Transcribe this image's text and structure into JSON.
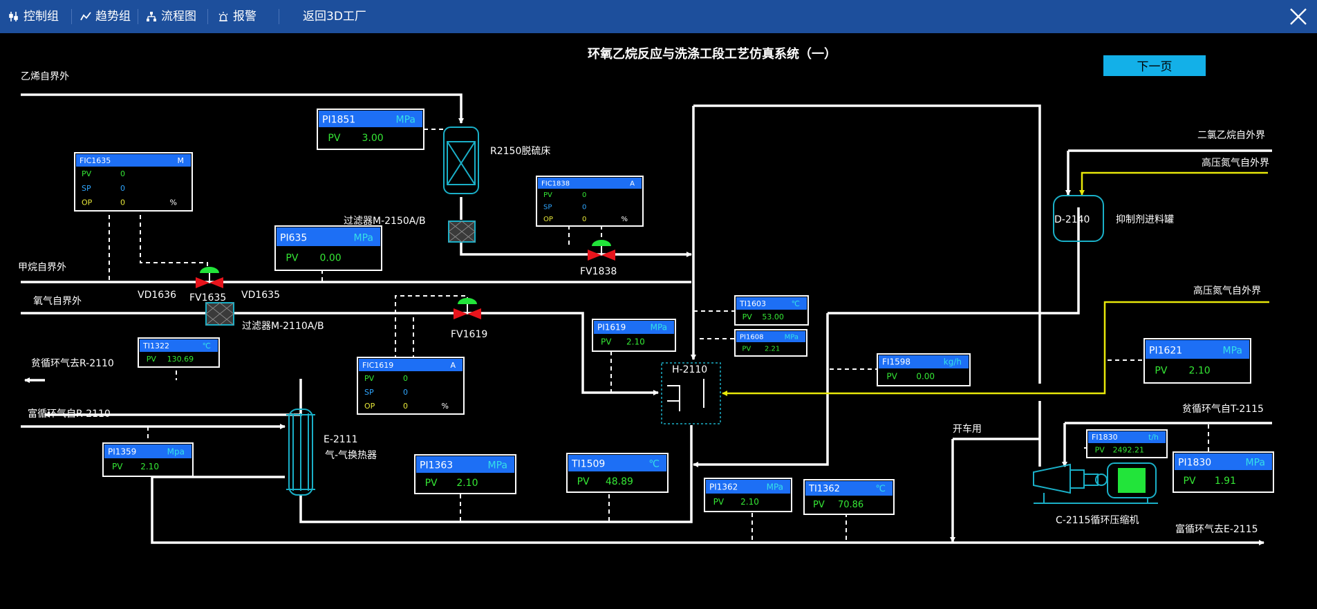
{
  "toolbar": {
    "items": [
      {
        "label": "控制组",
        "icon": "control-group-icon"
      },
      {
        "label": "趋势组",
        "icon": "trend-icon"
      },
      {
        "label": "流程图",
        "icon": "flowchart-icon"
      },
      {
        "label": "报警",
        "icon": "alarm-icon"
      }
    ],
    "back_label": "返回3D工厂",
    "close_icon": "close-icon"
  },
  "diagram": {
    "title": "环氧乙烷反应与洗涤工段工艺仿真系统（一）",
    "next_button": "下一页",
    "labels": {
      "ethylene_in": "乙烯自界外",
      "methane_in": "甲烷自界外",
      "oxygen_in": "氧气自界外",
      "lean_to_r2110": "贫循环气去R-2110",
      "rich_from_r2110": "富循环气自R-2110",
      "r2150": "R2150脱硫床",
      "filter_m2150": "过滤器M-2150A/B",
      "filter_m2110": "过滤器M-2110A/B",
      "vd1636": "VD1636",
      "fv1635": "FV1635",
      "vd1635": "VD1635",
      "fv1838": "FV1838",
      "fv1619": "FV1619",
      "e2111": "E-2111",
      "e2111_desc": "气-气换热器",
      "h2110": "H-2110",
      "d2140": "D-2140",
      "d2140_desc": "抑制剂进料罐",
      "dichloroethane_in": "二氯乙烷自外界",
      "hp_nitrogen_in_1": "高压氮气自外界",
      "hp_nitrogen_in_2": "高压氮气自外界",
      "lean_from_t2115": "贫循环气自T-2115",
      "startup": "开车用",
      "c2115": "C-2115循环压缩机",
      "rich_to_e2115": "富循环气去E-2115"
    },
    "instruments": [
      {
        "id": "pi1851",
        "tag": "PI1851",
        "unit": "MPa",
        "rows": [
          {
            "k": "PV",
            "v": "3.00"
          }
        ]
      },
      {
        "id": "fic1635",
        "tag": "FIC1635",
        "unit": "M",
        "rows": [
          {
            "k": "PV",
            "v": "0"
          },
          {
            "k": "SP",
            "v": "0"
          },
          {
            "k": "OP",
            "v": "0",
            "u": "%"
          }
        ]
      },
      {
        "id": "fic1838",
        "tag": "FIC1838",
        "unit": "A",
        "rows": [
          {
            "k": "PV",
            "v": "0"
          },
          {
            "k": "SP",
            "v": "0"
          },
          {
            "k": "OP",
            "v": "0",
            "u": "%"
          }
        ]
      },
      {
        "id": "pi635",
        "tag": "PI635",
        "unit": "MPa",
        "rows": [
          {
            "k": "PV",
            "v": "0.00"
          }
        ]
      },
      {
        "id": "ti1322",
        "tag": "TI1322",
        "unit": "℃",
        "rows": [
          {
            "k": "PV",
            "v": "130.69"
          }
        ]
      },
      {
        "id": "fic1619",
        "tag": "FIC1619",
        "unit": "A",
        "rows": [
          {
            "k": "PV",
            "v": "0"
          },
          {
            "k": "SP",
            "v": "0"
          },
          {
            "k": "OP",
            "v": "0",
            "u": "%"
          }
        ]
      },
      {
        "id": "pi1359",
        "tag": "PI1359",
        "unit": "Mpa",
        "rows": [
          {
            "k": "PV",
            "v": "2.10"
          }
        ]
      },
      {
        "id": "pi1619",
        "tag": "PI1619",
        "unit": "MPa",
        "rows": [
          {
            "k": "PV",
            "v": "2.10"
          }
        ]
      },
      {
        "id": "ti1603",
        "tag": "TI1603",
        "unit": "℃",
        "rows": [
          {
            "k": "PV",
            "v": "53.00"
          }
        ]
      },
      {
        "id": "pi1608",
        "tag": "PI1608",
        "unit": "MPa",
        "rows": [
          {
            "k": "PV",
            "v": "2.21"
          }
        ]
      },
      {
        "id": "fi1598",
        "tag": "FI1598",
        "unit": "kg/h",
        "rows": [
          {
            "k": "PV",
            "v": "0.00"
          }
        ]
      },
      {
        "id": "pi1621",
        "tag": "PI1621",
        "unit": "MPa",
        "rows": [
          {
            "k": "PV",
            "v": "2.10"
          }
        ]
      },
      {
        "id": "pi1363",
        "tag": "PI1363",
        "unit": "MPa",
        "rows": [
          {
            "k": "PV",
            "v": "2.10"
          }
        ]
      },
      {
        "id": "ti1509",
        "tag": "TI1509",
        "unit": "℃",
        "rows": [
          {
            "k": "PV",
            "v": "48.89"
          }
        ]
      },
      {
        "id": "pi1362",
        "tag": "PI1362",
        "unit": "MPa",
        "rows": [
          {
            "k": "PV",
            "v": "2.10"
          }
        ]
      },
      {
        "id": "ti1362",
        "tag": "TI1362",
        "unit": "℃",
        "rows": [
          {
            "k": "PV",
            "v": "70.86"
          }
        ]
      },
      {
        "id": "fi1830",
        "tag": "FI1830",
        "unit": "t/h",
        "rows": [
          {
            "k": "PV",
            "v": "2492.21"
          }
        ]
      },
      {
        "id": "pi1830",
        "tag": "PI1830",
        "unit": "MPa",
        "rows": [
          {
            "k": "PV",
            "v": "1.91"
          }
        ]
      }
    ],
    "colors": {
      "pv": "#35e835",
      "sp": "#2fa6ff",
      "op": "#e8e83a",
      "header": "#1d6ff5",
      "unit": "#35e0e8",
      "pipe": "#ffffff",
      "n2_pipe": "#e8e80a",
      "valve_body": "#e8141c",
      "valve_top": "#22e43a",
      "equipment": "#1ab0c8"
    }
  }
}
